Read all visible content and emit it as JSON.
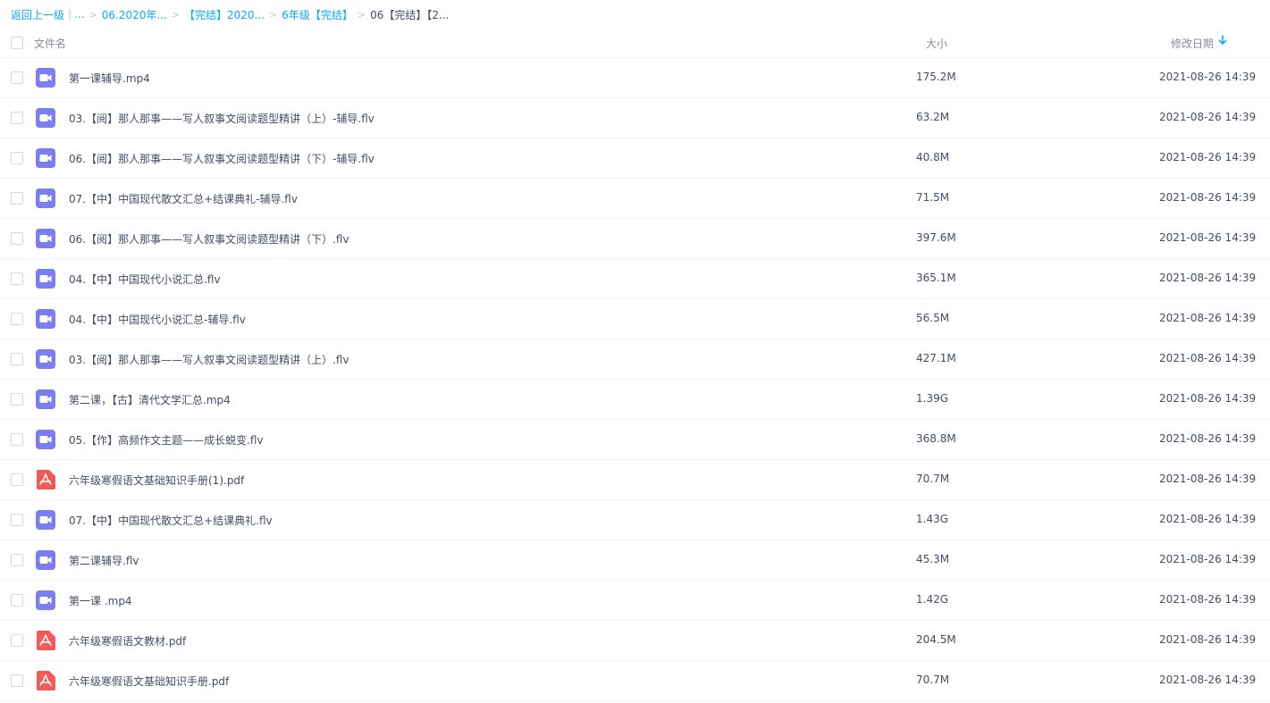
{
  "breadcrumb": {
    "back": "返回上一级",
    "ellipsis": "...",
    "items": [
      "06.2020年...",
      "【完结】2020...",
      "6年级【完结】"
    ],
    "current": "06【完结】【2..."
  },
  "columns": {
    "name": "文件名",
    "size": "大小",
    "modified": "修改日期"
  },
  "files": [
    {
      "name": "第一课辅导.mp4",
      "size": "175.2M",
      "date": "2021-08-26 14:39",
      "type": "video"
    },
    {
      "name": "03.【阅】那人那事——写人叙事文阅读题型精讲（上）-辅导.flv",
      "size": "63.2M",
      "date": "2021-08-26 14:39",
      "type": "video"
    },
    {
      "name": "06.【阅】那人那事——写人叙事文阅读题型精讲（下）-辅导.flv",
      "size": "40.8M",
      "date": "2021-08-26 14:39",
      "type": "video"
    },
    {
      "name": "07.【中】中国现代散文汇总+结课典礼-辅导.flv",
      "size": "71.5M",
      "date": "2021-08-26 14:39",
      "type": "video"
    },
    {
      "name": "06.【阅】那人那事——写人叙事文阅读题型精讲（下）.flv",
      "size": "397.6M",
      "date": "2021-08-26 14:39",
      "type": "video"
    },
    {
      "name": "04.【中】中国现代小说汇总.flv",
      "size": "365.1M",
      "date": "2021-08-26 14:39",
      "type": "video"
    },
    {
      "name": "04.【中】中国现代小说汇总-辅导.flv",
      "size": "56.5M",
      "date": "2021-08-26 14:39",
      "type": "video"
    },
    {
      "name": "03.【阅】那人那事——写人叙事文阅读题型精讲（上）.flv",
      "size": "427.1M",
      "date": "2021-08-26 14:39",
      "type": "video"
    },
    {
      "name": "第二课，【古】清代文学汇总.mp4",
      "size": "1.39G",
      "date": "2021-08-26 14:39",
      "type": "video"
    },
    {
      "name": "05.【作】高频作文主题——成长蜕变.flv",
      "size": "368.8M",
      "date": "2021-08-26 14:39",
      "type": "video"
    },
    {
      "name": "六年级寒假语文基础知识手册(1).pdf",
      "size": "70.7M",
      "date": "2021-08-26 14:39",
      "type": "pdf"
    },
    {
      "name": "07.【中】中国现代散文汇总+结课典礼.flv",
      "size": "1.43G",
      "date": "2021-08-26 14:39",
      "type": "video"
    },
    {
      "name": "第二课辅导.flv",
      "size": "45.3M",
      "date": "2021-08-26 14:39",
      "type": "video"
    },
    {
      "name": "第一课 .mp4",
      "size": "1.42G",
      "date": "2021-08-26 14:39",
      "type": "video"
    },
    {
      "name": "六年级寒假语文教材.pdf",
      "size": "204.5M",
      "date": "2021-08-26 14:39",
      "type": "pdf"
    },
    {
      "name": "六年级寒假语文基础知识手册.pdf",
      "size": "70.7M",
      "date": "2021-08-26 14:39",
      "type": "pdf"
    }
  ],
  "colors": {
    "link": "#09aaff",
    "video_icon": "#7b7ef0",
    "pdf_icon": "#f25a5a",
    "text": "#424e67",
    "header_text": "#878c9c"
  },
  "icons": {
    "video": "video-file-icon",
    "pdf": "pdf-file-icon",
    "sort": "sort-descending-arrow-icon"
  }
}
